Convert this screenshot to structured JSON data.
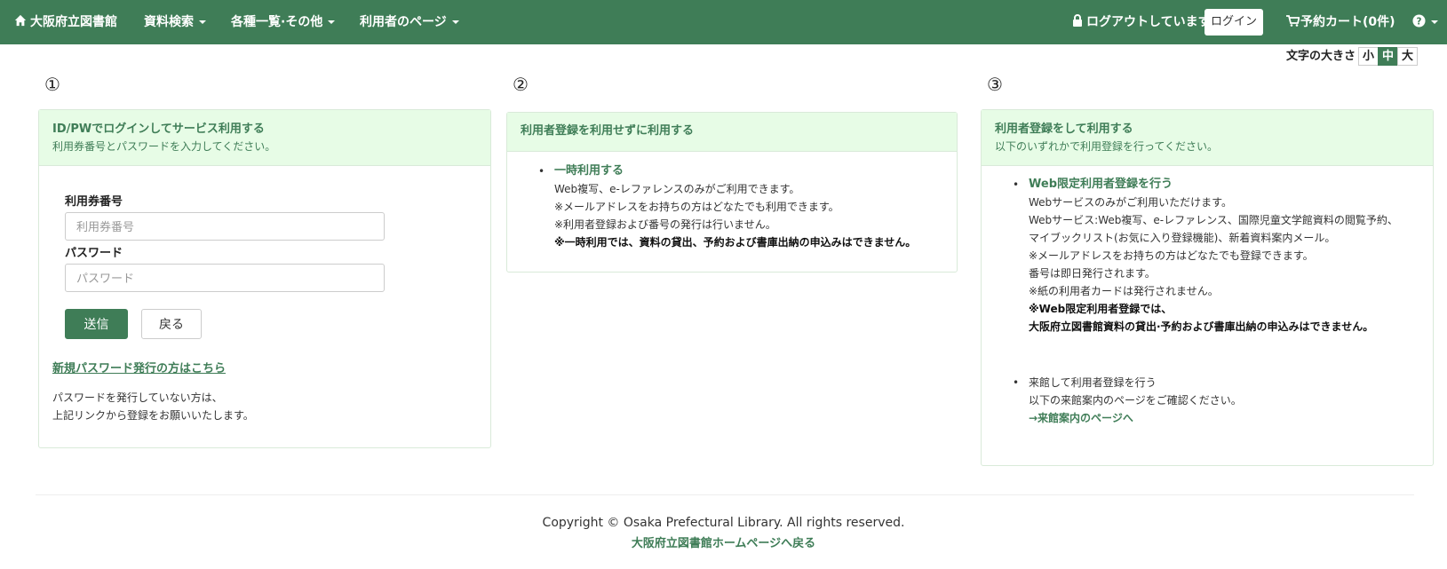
{
  "navbar": {
    "home": "大阪府立図書館",
    "menu": [
      "資料検索",
      "各種一覧·その他",
      "利用者のページ"
    ],
    "logout_status": "ログアウトしています",
    "login": "ログイン",
    "cart": "予約カート(0件)",
    "help_icon": "question-circle-icon",
    "color": "#3f7d57"
  },
  "fontsize": {
    "label": "文字の大きさ",
    "options": [
      "小",
      "中",
      "大"
    ],
    "active": "中"
  },
  "markers": [
    "①",
    "②",
    "③"
  ],
  "panel1": {
    "title": "ID/PWでログインしてサービス利用する",
    "subtitle": "利用券番号とパスワードを入力してください。",
    "id_label": "利用券番号",
    "id_placeholder": "利用券番号",
    "pw_label": "パスワード",
    "pw_placeholder": "パスワード",
    "submit": "送信",
    "back": "戻る",
    "new_pw_link": "新規パスワード発行の方はこちら",
    "note1": "パスワードを発行していない方は、",
    "note2": "上記リンクから登録をお願いいたします。"
  },
  "panel2": {
    "title": "利用者登録を利用せずに利用する",
    "item_title": "一時利用する",
    "lines": [
      "Web複写、e-レファレンスのみがご利用できます。",
      "※メールアドレスをお持ちの方はどなたでも利用できます。",
      "※利用者登録および番号の発行は行いません。"
    ],
    "warning": "※一時利用では、資料の貸出、予約および書庫出納の申込みはできません。"
  },
  "panel3": {
    "title": "利用者登録をして利用する",
    "subtitle": "以下のいずれかで利用登録を行ってください。",
    "item1_title": "Web限定利用者登録を行う",
    "item1_lines": [
      "Webサービスのみがご利用いただけます。",
      "Webサービス:Web複写、e-レファレンス、国際児童文学館資料の閲覧予約、",
      "マイブックリスト(お気に入り登録機能)、新着資料案内メール。",
      "※メールアドレスをお持ちの方はどなたでも登録できます。",
      "番号は即日発行されます。",
      "※紙の利用者カードは発行されません。"
    ],
    "item1_warning1": "※Web限定利用者登録では、",
    "item1_warning2": "大阪府立図書館資料の貸出·予約および書庫出納の申込みはできません。",
    "item2_title": "来館して利用者登録を行う",
    "item2_line": "以下の来館案内のページをご確認ください。",
    "item2_link": "→来館案内のページへ"
  },
  "footer": {
    "copyright": "Copyright © Osaka Prefectural Library. All rights reserved.",
    "home_link": "大阪府立図書館ホームページへ戻る"
  }
}
